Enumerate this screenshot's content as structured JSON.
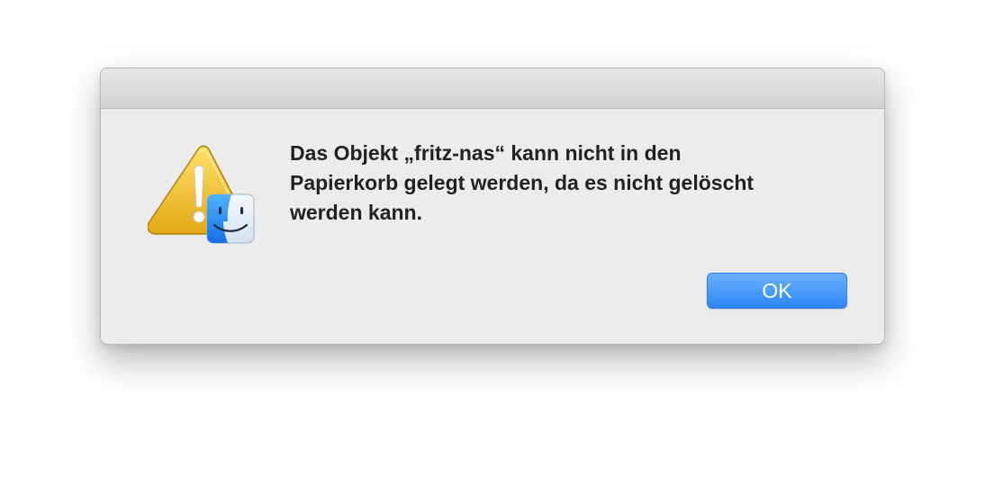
{
  "dialog": {
    "message": "Das Objekt „fritz-nas“ kann nicht in den Papierkorb gelegt werden, da es nicht gelöscht werden kann.",
    "ok_label": "OK",
    "icon": "warning-triangle-with-finder-badge"
  },
  "colors": {
    "dialog_background": "#ececec",
    "titlebar_top": "#e8e8e8",
    "titlebar_bottom": "#d2d2d2",
    "button_accent": "#3a8ef9",
    "warning_yellow": "#f1c232",
    "finder_blue": "#2b8df0"
  }
}
